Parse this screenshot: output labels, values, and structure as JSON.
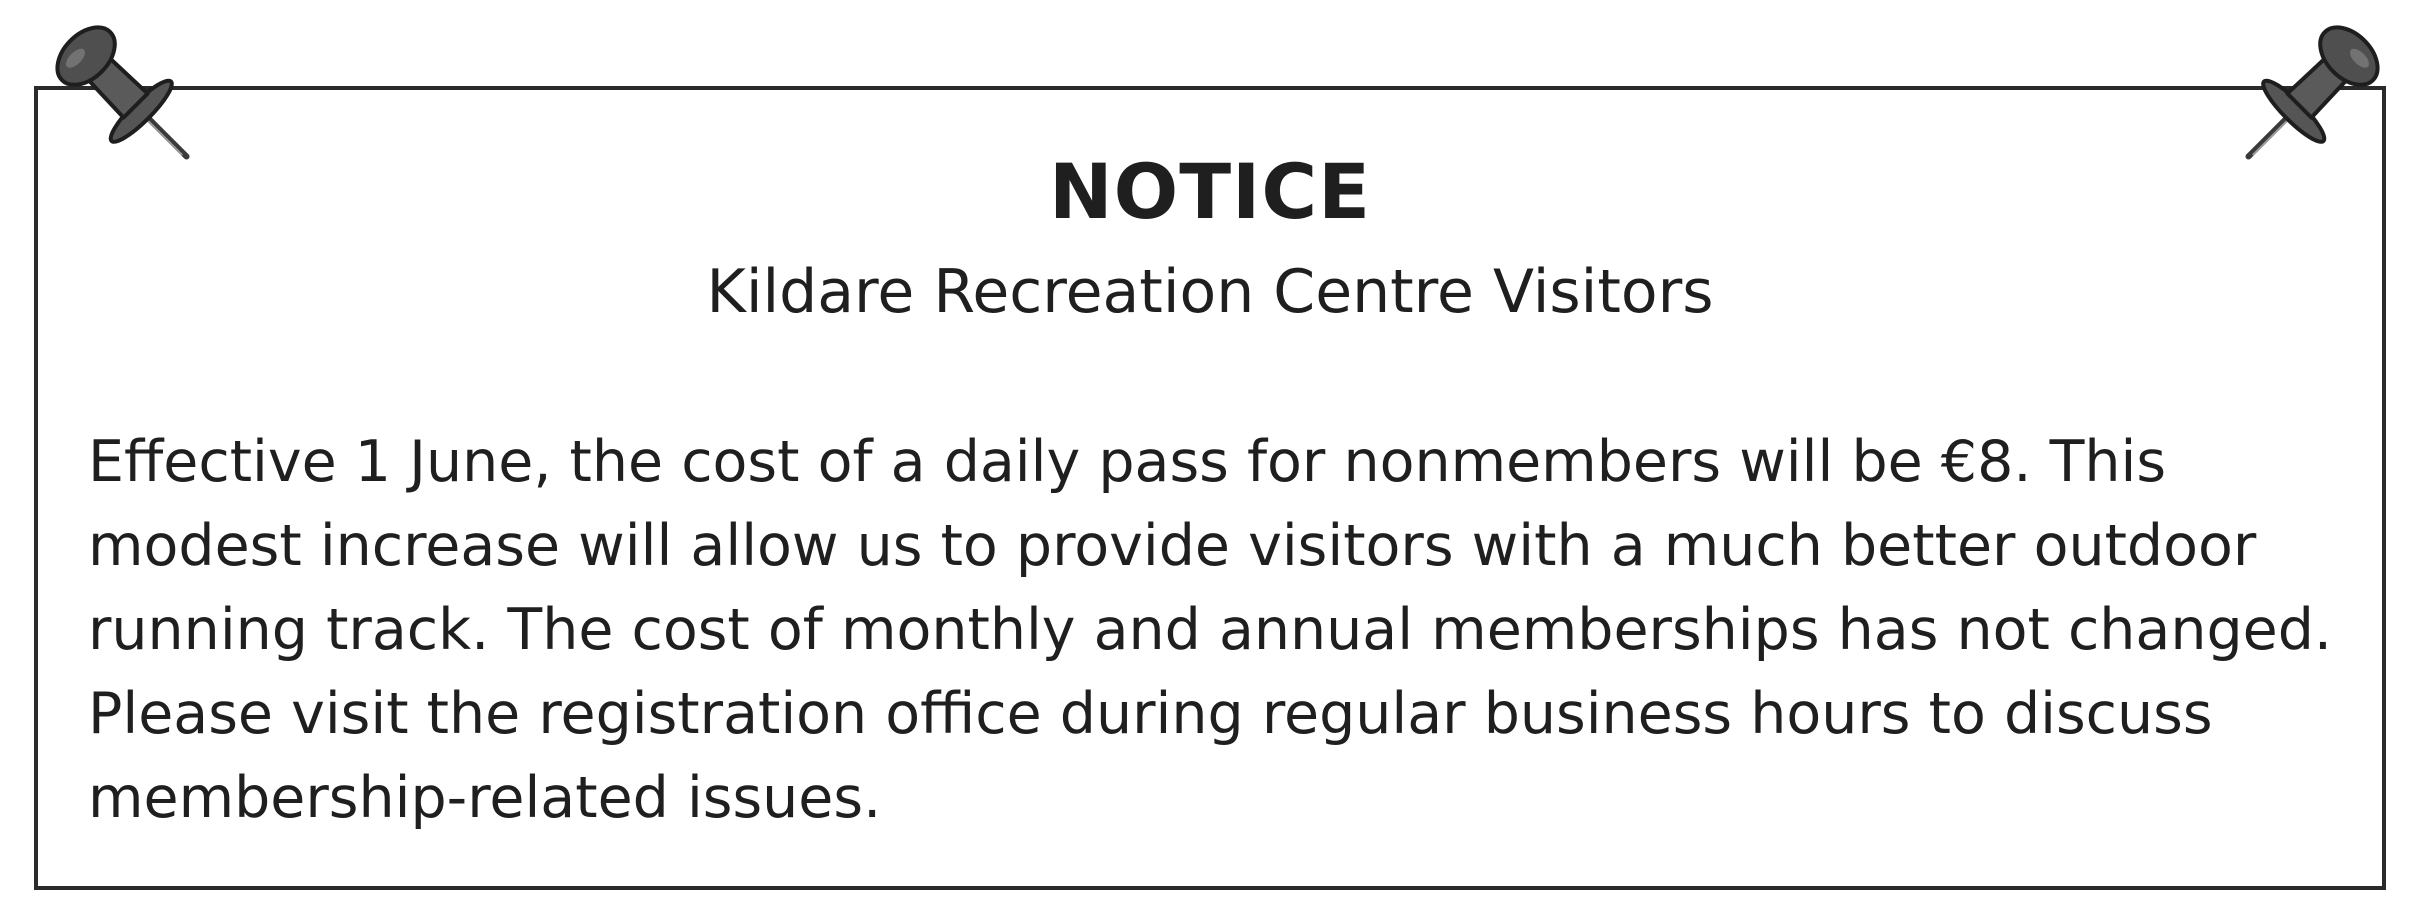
{
  "notice": {
    "title": "NOTICE",
    "subtitle": "Kildare Recreation Centre Visitors",
    "body_lines": [
      "Effective 1 June, the cost of a daily pass for nonmembers will be €8. This",
      "modest increase will allow us to provide visitors with a much better outdoor",
      "running track. The cost of monthly and annual memberships has not changed.",
      "Please visit the registration office during regular business hours to discuss",
      "membership-related issues."
    ]
  },
  "icons": {
    "left_pin": "pushpin-icon",
    "right_pin": "pushpin-icon"
  },
  "colors": {
    "border": "#2b2b2b",
    "pin": "#555555",
    "text": "#1f1f1f",
    "background": "#ffffff"
  }
}
